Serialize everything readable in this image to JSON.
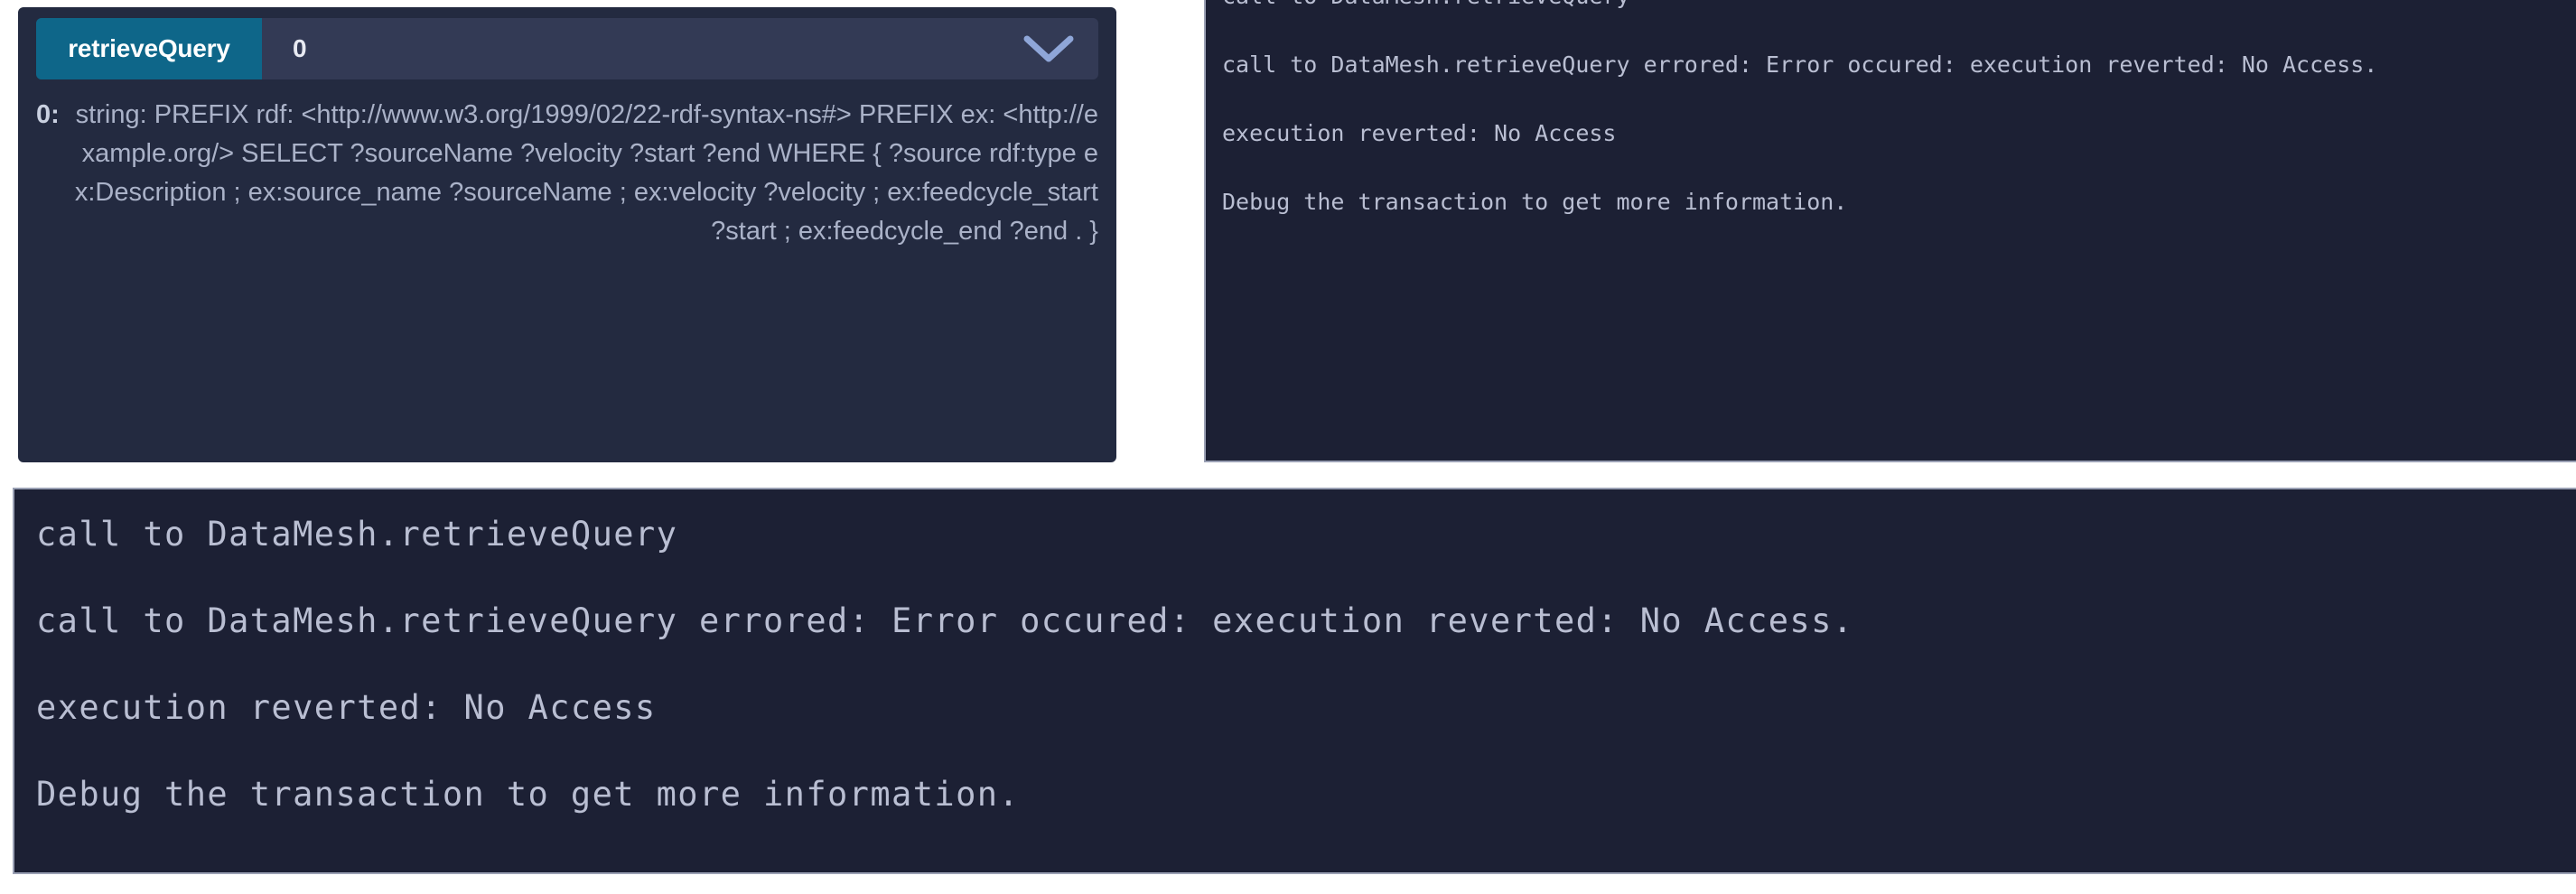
{
  "colors": {
    "panel_background": "#232a40",
    "header_field_background": "#333a55",
    "function_pill_background": "#0e6689",
    "console_background": "#1c2034",
    "console_border": "#9aa0b4",
    "console_text": "#b9bed2",
    "chevron": "#8fa6d8",
    "page_background": "#ffffff"
  },
  "call_panel": {
    "function_name": "retrieveQuery",
    "argument_count_value": "0",
    "expand_chevron_icon": "chevron-down-icon",
    "argument": {
      "index_label": "0:",
      "value": "string: PREFIX rdf: <http://www.w3.org/1999/02/22-rdf-syntax-ns#> PREFIX ex: <http://example.org/> SELECT ?sourceName ?velocity ?start ?end WHERE { ?source rdf:type ex:Description ; ex:source_name ?sourceName ; ex:velocity ?velocity ; ex:feedcycle_start ?start ; ex:feedcycle_end ?end . }"
    }
  },
  "console_top": {
    "lines": [
      "call to DataMesh.retrieveQuery",
      "call to DataMesh.retrieveQuery errored: Error occured: execution reverted: No Access.",
      "execution reverted: No Access",
      "Debug the transaction to get more information."
    ]
  },
  "console_bottom": {
    "lines": [
      "call to DataMesh.retrieveQuery",
      "call to DataMesh.retrieveQuery errored: Error occured: execution reverted: No Access.",
      "execution reverted: No Access",
      "Debug the transaction to get more information."
    ]
  }
}
